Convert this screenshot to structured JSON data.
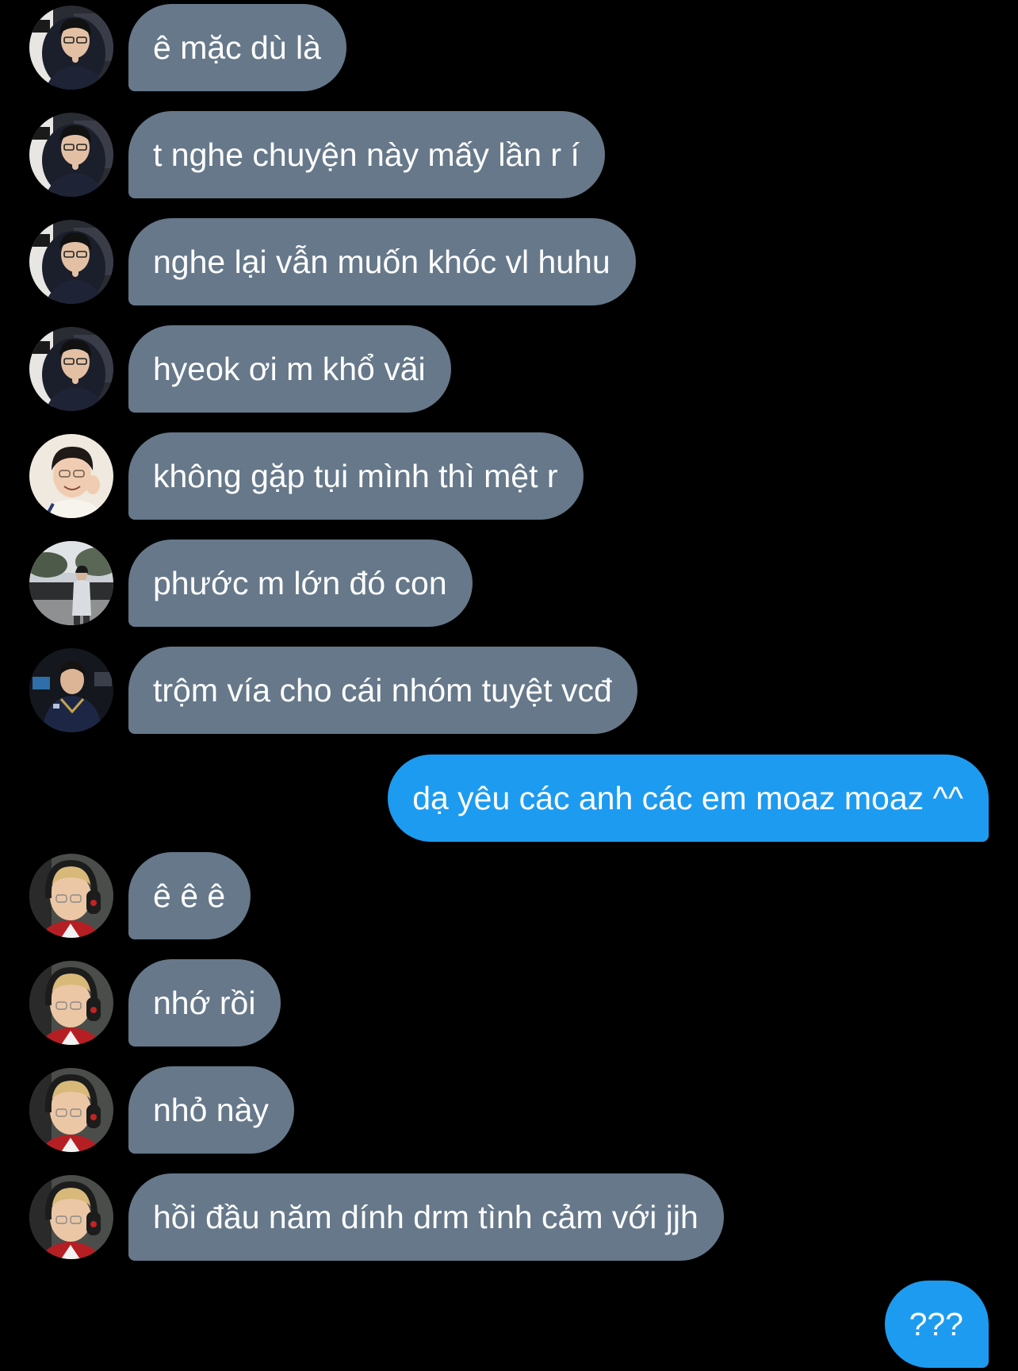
{
  "thread": {
    "messages": [
      {
        "sender": "incoming",
        "avatar": "user-a-avatar",
        "text": "ê mặc dù là"
      },
      {
        "sender": "incoming",
        "avatar": "user-a-avatar",
        "text": "t nghe chuyện này mấy lần r í"
      },
      {
        "sender": "incoming",
        "avatar": "user-a-avatar",
        "text": "nghe lại vẫn muốn khóc vl huhu"
      },
      {
        "sender": "incoming",
        "avatar": "user-a-avatar",
        "text": "hyeok ơi m khổ vãi"
      },
      {
        "sender": "incoming",
        "avatar": "user-b-avatar",
        "text": "không gặp tụi mình thì mệt r"
      },
      {
        "sender": "incoming",
        "avatar": "user-c-avatar",
        "text": "phước m lớn đó con"
      },
      {
        "sender": "incoming",
        "avatar": "user-d-avatar",
        "text": "trộm vía cho cái nhóm tuyệt vcđ"
      },
      {
        "sender": "outgoing",
        "text": "dạ yêu các anh các em moaz moaz ^^"
      },
      {
        "sender": "incoming",
        "avatar": "user-e-avatar",
        "text": "ê ê ê"
      },
      {
        "sender": "incoming",
        "avatar": "user-e-avatar",
        "text": "nhớ rồi"
      },
      {
        "sender": "incoming",
        "avatar": "user-e-avatar",
        "text": "nhỏ này"
      },
      {
        "sender": "incoming",
        "avatar": "user-e-avatar",
        "text": "hồi đầu năm dính drm tình cảm với jjh"
      },
      {
        "sender": "outgoing",
        "text": "???"
      }
    ]
  },
  "colors": {
    "background": "#000000",
    "incoming_bubble": "#66788a",
    "outgoing_bubble": "#1d9bf0",
    "text": "#ffffff"
  }
}
